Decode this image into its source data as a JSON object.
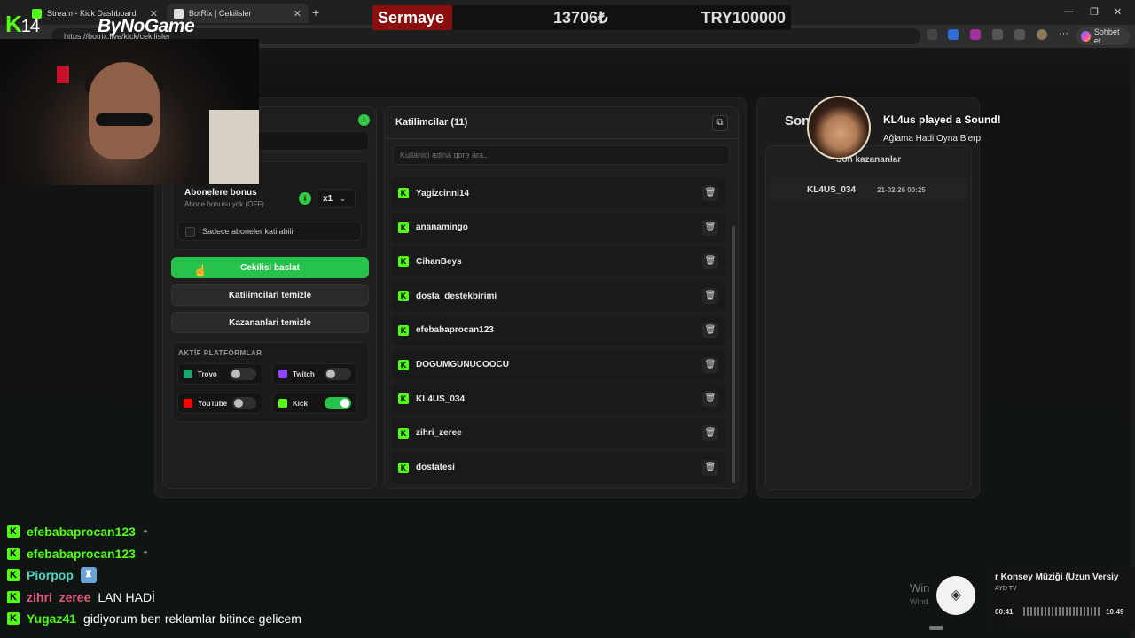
{
  "browser": {
    "tabs": [
      {
        "title": "Stream - Kick Dashboard"
      },
      {
        "title": "BotRix | Cekilisler"
      }
    ],
    "url": "https://botrix.live/kick/cekilisler",
    "copilot_label": "Sohbet et"
  },
  "overlay": {
    "channel_logo": "K",
    "channel_number": "14",
    "sponsor": "ByNoGame",
    "sermaye_label": "Sermaye",
    "sermaye_value": "13706₺",
    "sermaye_target": "TRY100000"
  },
  "giveaway": {
    "bonus_title": "Abonelere bonus",
    "bonus_sub": "Abone bonusu yok (OFF)",
    "multiplier": "x1",
    "sub_only_label": "Sadece aboneler katilabilir",
    "start_button": "Cekilisi baslat",
    "clear_participants_button": "Katilimcilari temizle",
    "clear_winners_button": "Kazananlari temizle",
    "platforms_title": "AKTİF PLATFORMLAR",
    "platforms": [
      {
        "name": "Trovo",
        "enabled": false,
        "color": "#1ba56c"
      },
      {
        "name": "Twitch",
        "enabled": false,
        "color": "#9146ff"
      },
      {
        "name": "YouTube",
        "enabled": false,
        "color": "#ff0000"
      },
      {
        "name": "Kick",
        "enabled": true,
        "color": "#53fc18"
      }
    ]
  },
  "participants": {
    "title": "Katilimcilar (11)",
    "search_placeholder": "Kullanici adina gore ara...",
    "items": [
      {
        "name": "Yagizcinni14"
      },
      {
        "name": "ananamingo"
      },
      {
        "name": "CihanBeys"
      },
      {
        "name": "dosta_destekbirimi"
      },
      {
        "name": "efebabaprocan123"
      },
      {
        "name": "DOGUMGUNUCOOCU"
      },
      {
        "name": "KL4US_034"
      },
      {
        "name": "zihri_zeree"
      },
      {
        "name": "dostatesi"
      }
    ]
  },
  "winners": {
    "panel_title": "Son",
    "header": "Son kazananlar",
    "items": [
      {
        "name": "KL4US_034",
        "date": "21-02-26 00:25"
      }
    ]
  },
  "alert": {
    "title": "KL4us played a Sound!",
    "subtitle": "Ağlama Hadi Oyna Blerp"
  },
  "chat": [
    {
      "user": "efebabaprocan123",
      "color": "#53fc18",
      "message": ""
    },
    {
      "user": "efebabaprocan123",
      "color": "#53fc18",
      "message": ""
    },
    {
      "user": "Piorpop",
      "color": "#4fd1c5",
      "message": ""
    },
    {
      "user": "zihri_zeree",
      "color": "#e05a7a",
      "message": "LAN HADİ"
    },
    {
      "user": "Yugaz41",
      "color": "#53fc18",
      "message": "gidiyorum ben reklamlar bitince gelicem"
    }
  ],
  "media": {
    "title": "r Konsey Müziği (Uzun Versiy",
    "artist": "AYD TV",
    "time_current": "00:41",
    "time_total": "10:49"
  },
  "windows": {
    "activate": "Win",
    "activate_sub": "Wind"
  }
}
